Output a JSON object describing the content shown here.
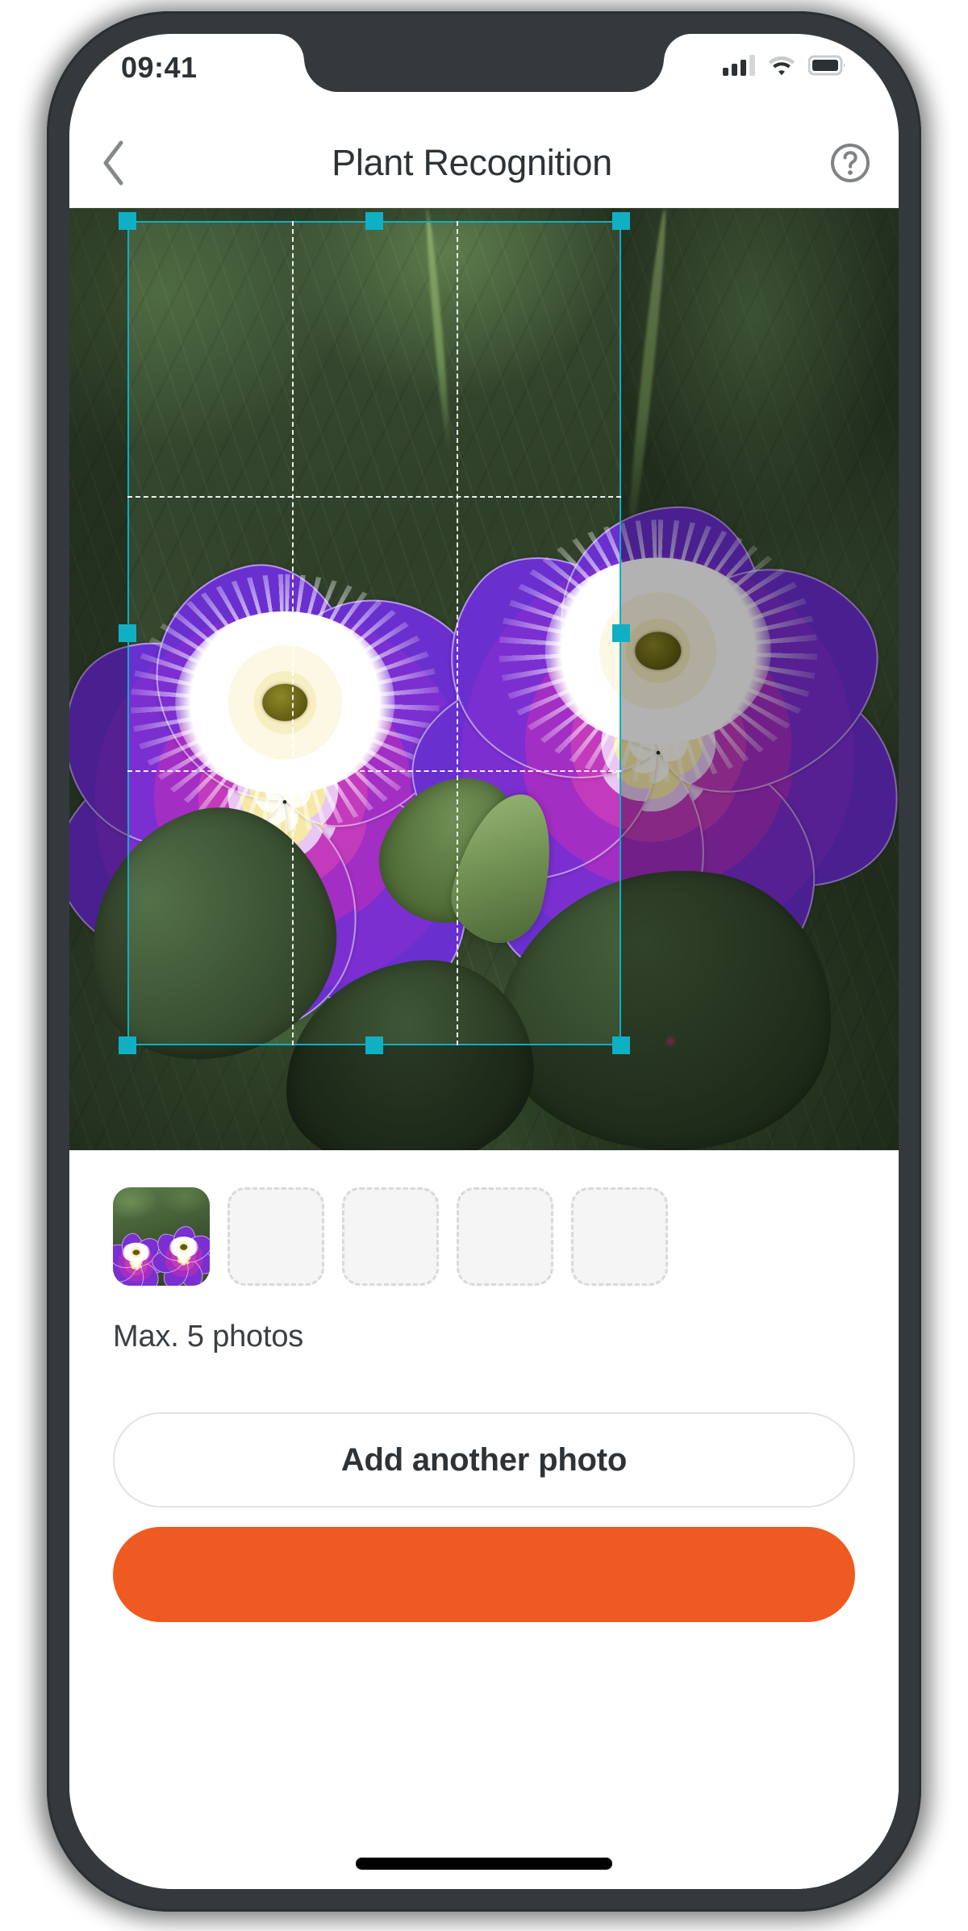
{
  "status_bar": {
    "time": "09:41",
    "cellular_icon": "cellular-signal-icon",
    "cellular_bars_filled": 3,
    "cellular_bars_total": 4,
    "wifi_icon": "wifi-icon",
    "battery_icon": "battery-full-icon"
  },
  "header": {
    "back_icon": "chevron-left-icon",
    "title": "Plant Recognition",
    "help_icon": "question-mark-circle-icon"
  },
  "photo_editor": {
    "name": "crop-photo-editor",
    "subject": "two purple primrose flowers with white and yellow centers on green leaves",
    "crop_overlay": {
      "accent_color": "#10AEC3",
      "grid": "rule-of-thirds",
      "grid_line_style": "dashed",
      "handles": [
        "top-left",
        "top-center",
        "top-right",
        "middle-left",
        "middle-right",
        "bottom-left",
        "bottom-center",
        "bottom-right"
      ]
    }
  },
  "thumbnails": {
    "slots": [
      {
        "state": "filled",
        "label": "photo-1",
        "alt": "purple primrose flowers"
      },
      {
        "state": "empty",
        "label": "photo-2"
      },
      {
        "state": "empty",
        "label": "photo-3"
      },
      {
        "state": "empty",
        "label": "photo-4"
      },
      {
        "state": "empty",
        "label": "photo-5"
      }
    ],
    "max_note": "Max. 5 photos"
  },
  "actions": {
    "secondary_label": "Add another photo",
    "primary_label": "",
    "primary_color": "#EF5A22"
  },
  "home_indicator": "home-indicator"
}
